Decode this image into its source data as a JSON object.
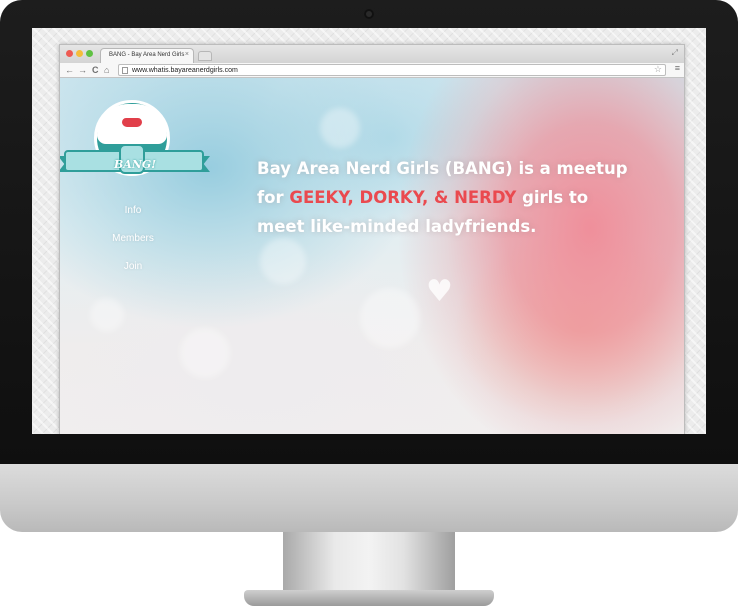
{
  "browser": {
    "tab_title": "BANG - Bay Area Nerd Girls",
    "tab_close": "×",
    "url": "www.whatis.bayareanerdgirls.com",
    "back_glyph": "←",
    "forward_glyph": "→",
    "reload_glyph": "C",
    "home_glyph": "⌂",
    "star_glyph": "☆",
    "menu_glyph": "≡",
    "expand_glyph": "⤢"
  },
  "logo": {
    "text": "BANG!"
  },
  "nav": {
    "items": [
      {
        "label": "Info"
      },
      {
        "label": "Members"
      },
      {
        "label": "Join"
      }
    ]
  },
  "headline": {
    "line1": "Bay Area Nerd Girls (BANG) is a meetup",
    "line2_pre": "for ",
    "line2_highlight": "GEEKY, DORKY, & NERDY",
    "line2_post": " girls to",
    "line3": "meet like-minded ladyfriends."
  },
  "decor": {
    "heart_glyph": "♥"
  },
  "colors": {
    "accent_red": "#ea4a4f",
    "teal": "#2f9e9a",
    "ribbon": "#a9e0e2"
  }
}
